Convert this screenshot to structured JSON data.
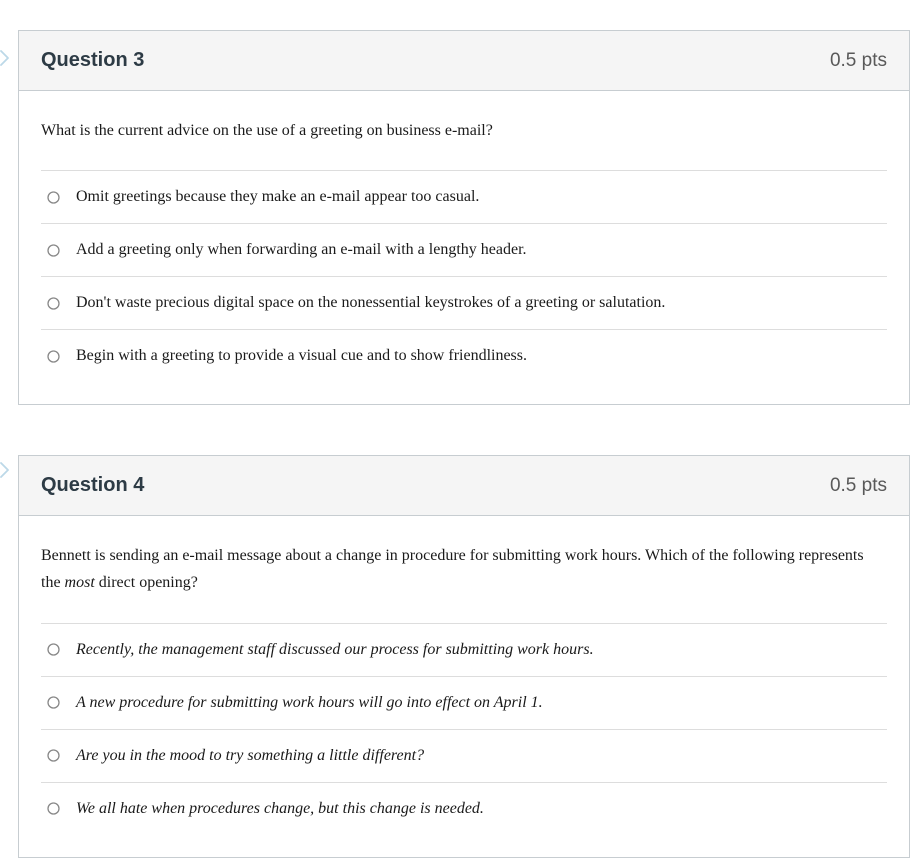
{
  "questions": [
    {
      "title": "Question 3",
      "points": "0.5 pts",
      "prompt_plain": "What is the current advice on the use of a greeting on business e-mail?",
      "prompt_html": "What is the current advice on the use of a greeting on business e-mail?",
      "answers_italic": false,
      "answers": [
        "Omit greetings because they make an e-mail appear too casual.",
        "Add a greeting only when forwarding an e-mail with a lengthy header.",
        "Don't waste precious digital space on the nonessential keystrokes of a greeting or salutation.",
        "Begin with a greeting to provide a visual cue and to show friendliness."
      ]
    },
    {
      "title": "Question 4",
      "points": "0.5 pts",
      "prompt_plain": "Bennett is sending an e-mail message about a change in procedure for submitting work hours. Which of the following represents the most direct opening?",
      "prompt_html": "Bennett is sending an e-mail message about a change in procedure for submitting work hours. Which of the following represents the <span class=\"italic-word\">most</span> direct opening?",
      "answers_italic": true,
      "answers": [
        "Recently, the management staff discussed our process for submitting work hours.",
        "A new procedure for submitting work hours will go into effect on April 1.",
        "Are you in the mood to try something a little different?",
        "We all hate when procedures change, but this change is needed."
      ]
    }
  ]
}
